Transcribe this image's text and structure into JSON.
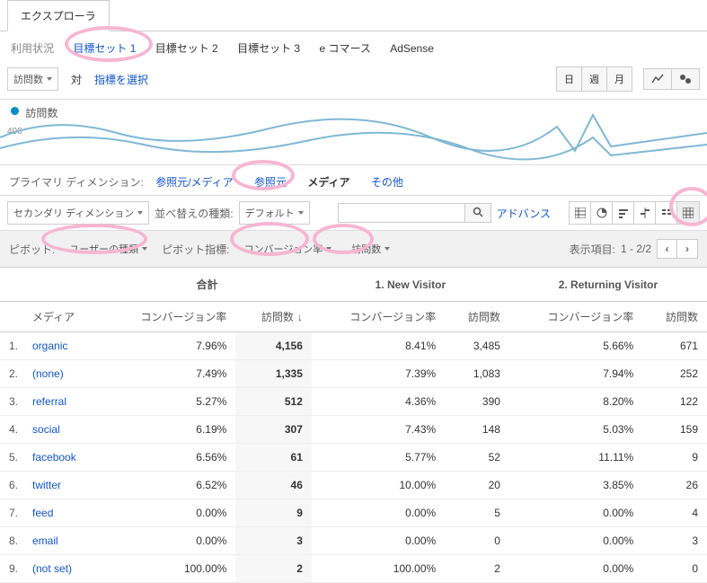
{
  "tabs": {
    "explorer": "エクスプローラ"
  },
  "subTabs": {
    "usage": "利用状況",
    "goalSet1": "目標セット 1",
    "goalSet2": "目標セット 2",
    "goalSet3": "目標セット 3",
    "ecommerce": "e コマース",
    "adsense": "AdSense"
  },
  "metric": {
    "primary": "訪問数",
    "vs": "対",
    "selectMetric": "指標を選択",
    "legend": "訪問数",
    "axis400": "400"
  },
  "timeButtons": {
    "day": "日",
    "week": "週",
    "month": "月"
  },
  "dimRow": {
    "label": "プライマリ ディメンション:",
    "sourceMedium": "参照元/メディア",
    "source": "参照元",
    "medium": "メディア",
    "other": "その他"
  },
  "toolbar": {
    "secondaryDim": "セカンダリ ディメンション",
    "sortTypeLabel": "並べ替えの種類:",
    "sortDefault": "デフォルト",
    "advanced": "アドバンス"
  },
  "pivot": {
    "label": "ピボット:",
    "userType": "ユーザーの種類",
    "metricLabel": "ピボット指標:",
    "convRate": "コンバージョン率",
    "visits": "訪問数",
    "displayItems": "表示項目:",
    "pageInfo": "1 - 2/2"
  },
  "headers": {
    "summary": "合計",
    "col1": "1. New Visitor",
    "col2": "2. Returning Visitor",
    "media": "メディア",
    "convRate": "コンバージョン率",
    "visits": "訪問数"
  },
  "rows": [
    {
      "i": "1.",
      "m": "organic",
      "sc": "7.96%",
      "sv": "4,156",
      "c1c": "8.41%",
      "c1v": "3,485",
      "c2c": "5.66%",
      "c2v": "671"
    },
    {
      "i": "2.",
      "m": "(none)",
      "sc": "7.49%",
      "sv": "1,335",
      "c1c": "7.39%",
      "c1v": "1,083",
      "c2c": "7.94%",
      "c2v": "252"
    },
    {
      "i": "3.",
      "m": "referral",
      "sc": "5.27%",
      "sv": "512",
      "c1c": "4.36%",
      "c1v": "390",
      "c2c": "8.20%",
      "c2v": "122"
    },
    {
      "i": "4.",
      "m": "social",
      "sc": "6.19%",
      "sv": "307",
      "c1c": "7.43%",
      "c1v": "148",
      "c2c": "5.03%",
      "c2v": "159"
    },
    {
      "i": "5.",
      "m": "facebook",
      "sc": "6.56%",
      "sv": "61",
      "c1c": "5.77%",
      "c1v": "52",
      "c2c": "11.11%",
      "c2v": "9"
    },
    {
      "i": "6.",
      "m": "twitter",
      "sc": "6.52%",
      "sv": "46",
      "c1c": "10.00%",
      "c1v": "20",
      "c2c": "3.85%",
      "c2v": "26"
    },
    {
      "i": "7.",
      "m": "feed",
      "sc": "0.00%",
      "sv": "9",
      "c1c": "0.00%",
      "c1v": "5",
      "c2c": "0.00%",
      "c2v": "4"
    },
    {
      "i": "8.",
      "m": "email",
      "sc": "0.00%",
      "sv": "3",
      "c1c": "0.00%",
      "c1v": "0",
      "c2c": "0.00%",
      "c2v": "3"
    },
    {
      "i": "9.",
      "m": "(not set)",
      "sc": "100.00%",
      "sv": "2",
      "c1c": "100.00%",
      "c1v": "2",
      "c2c": "0.00%",
      "c2v": "0"
    }
  ]
}
